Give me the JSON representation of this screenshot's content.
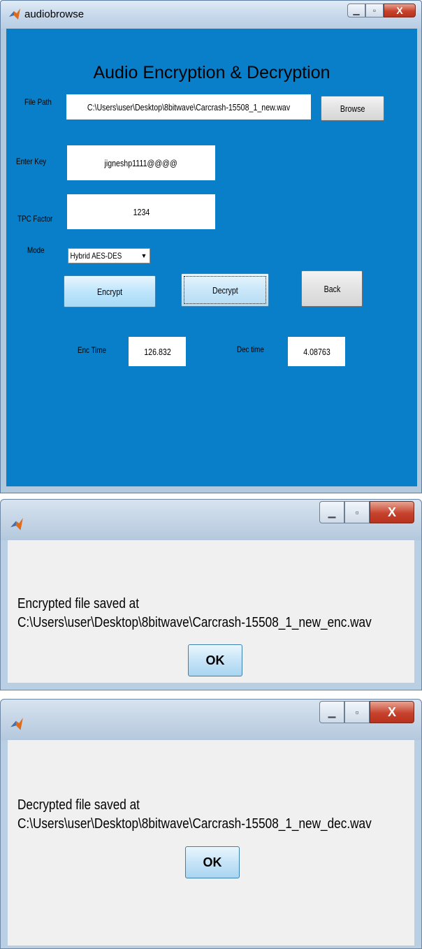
{
  "window": {
    "title": "audiobrowse",
    "heading": "Audio Encryption & Decryption"
  },
  "form": {
    "file_path_label": "File Path",
    "file_path_value": "C:\\Users\\user\\Desktop\\8bitwave\\Carcrash-15508_1_new.wav",
    "browse_label": "Browse",
    "key_label": "Enter Key",
    "key_value": "jigneshp1111@@@@",
    "tpc_label": "TPC Factor",
    "tpc_value": "1234",
    "mode_label": "Mode",
    "mode_value": "Hybrid AES-DES",
    "encrypt_label": "Encrypt",
    "decrypt_label": "Decrypt",
    "back_label": "Back",
    "enc_time_label": "Enc Time",
    "enc_time_value": "126.832",
    "dec_time_label": "Dec time",
    "dec_time_value": "4.08763"
  },
  "dialog_encrypt": {
    "line1": "Encrypted file saved at",
    "line2": "C:\\Users\\user\\Desktop\\8bitwave\\Carcrash-15508_1_new_enc.wav",
    "ok_label": "OK"
  },
  "dialog_decrypt": {
    "line1": "Decrypted file saved at",
    "line2": "C:\\Users\\user\\Desktop\\8bitwave\\Carcrash-15508_1_new_dec.wav",
    "ok_label": "OK"
  },
  "icons": {
    "app": "matlab-logo-icon",
    "minimize": "minimize-icon",
    "maximize": "maximize-icon",
    "close": "close-icon",
    "dropdown": "chevron-down-icon"
  },
  "colors": {
    "panel": "#0a7fc9",
    "close_button": "#c7422d"
  }
}
